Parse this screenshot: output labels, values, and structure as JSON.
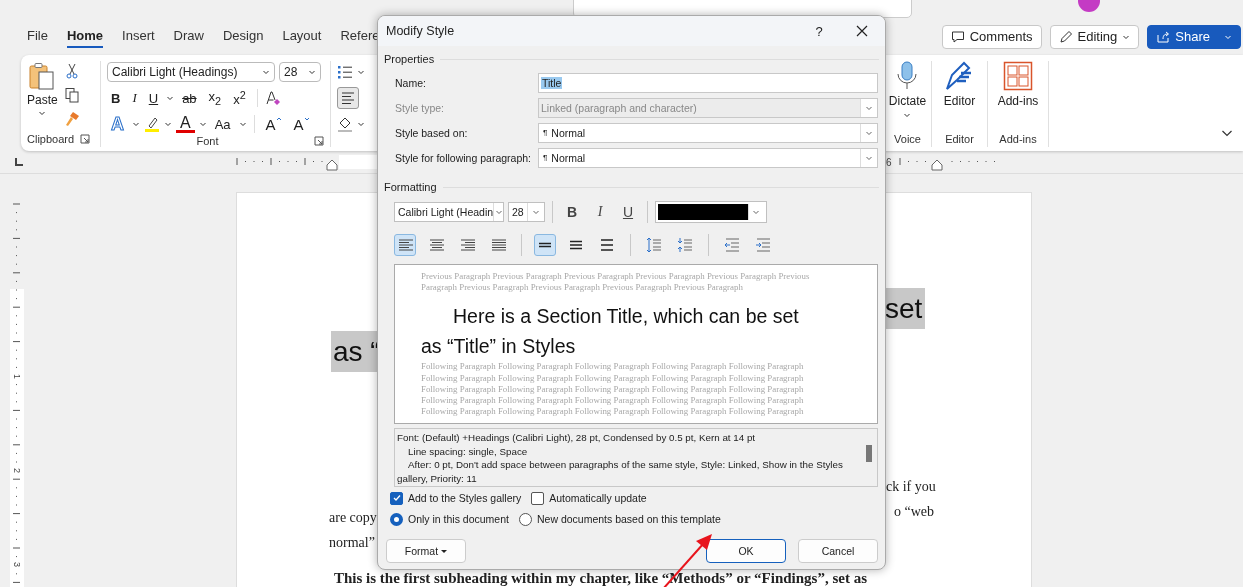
{
  "ribbon_tabs": [
    {
      "label": "File",
      "selected": false
    },
    {
      "label": "Home",
      "selected": true
    },
    {
      "label": "Insert",
      "selected": false
    },
    {
      "label": "Draw",
      "selected": false
    },
    {
      "label": "Design",
      "selected": false
    },
    {
      "label": "Layout",
      "selected": false
    },
    {
      "label": "Refere",
      "selected": false
    }
  ],
  "header_buttons": {
    "comments": "Comments",
    "editing": "Editing",
    "share": "Share"
  },
  "ribbon": {
    "clipboard": {
      "paste": "Paste",
      "label": "Clipboard"
    },
    "font": {
      "name": "Calibri Light (Headings)",
      "size": "28",
      "label": "Font",
      "format_buttons": [
        {
          "label": "B",
          "kind": "bold"
        },
        {
          "label": "I",
          "kind": "italic"
        },
        {
          "label": "U",
          "kind": "underline"
        },
        {
          "label": "ab",
          "kind": "strikethrough"
        },
        {
          "label": "x$_{2}$",
          "kind": "subscript"
        },
        {
          "label": "x$^{2}$",
          "kind": "superscript"
        }
      ],
      "effect_buttons": [
        {
          "label": "A",
          "kind": "text-effects"
        },
        {
          "label": "A",
          "kind": "font-color"
        },
        {
          "label": "Aa",
          "kind": "case"
        },
        {
          "label": "A",
          "kind": "grow"
        },
        {
          "label": "A",
          "kind": "shrink"
        }
      ]
    },
    "paragraph": {
      "align_left": {
        "selected": true
      }
    },
    "voice": {
      "button": "Dictate",
      "label": "Voice"
    },
    "editor": {
      "button": "Editor",
      "label": "Editor"
    },
    "addins": {
      "button": "Add-ins",
      "label": "Add-ins"
    }
  },
  "ruler": {
    "horizontal_number": "6",
    "vertical_numbers": [
      "1",
      "2",
      "3"
    ]
  },
  "document": {
    "title_right": "set",
    "title_left": "as “",
    "body_right": [
      "ck if you",
      "o “web"
    ],
    "body_left": [
      "are copy",
      "normal”"
    ],
    "subheading": "This is the first subheading within my chapter, like “Methods” or “Findings”, set as"
  },
  "dialog": {
    "title": "Modify Style",
    "help": "?",
    "properties_heading": "Properties",
    "fields": [
      {
        "label": "Name:",
        "value": "Title",
        "kind": "text",
        "disabled": false,
        "text_selected": true
      },
      {
        "label": "Style type:",
        "value": "Linked (paragraph and character)",
        "kind": "dropdown",
        "disabled": true
      },
      {
        "label": "Style based on:",
        "prefix": "¶",
        "value": "Normal",
        "kind": "dropdown",
        "disabled": false
      },
      {
        "label": "Style for following paragraph:",
        "prefix": "¶",
        "value": "Normal",
        "kind": "dropdown",
        "disabled": false
      }
    ],
    "formatting_heading": "Formatting",
    "font": "Calibri Light (Headin",
    "size": "28",
    "styles": [
      {
        "label": "B",
        "kind": "bold",
        "selected": false
      },
      {
        "label": "I",
        "kind": "italic",
        "selected": false
      },
      {
        "label": "U",
        "kind": "underline",
        "selected": false
      }
    ],
    "tool_groups": [
      [
        {
          "kind": "align-left",
          "selected": true
        },
        {
          "kind": "align-center",
          "selected": false
        },
        {
          "kind": "align-right",
          "selected": false
        },
        {
          "kind": "justify",
          "selected": false
        }
      ],
      [
        {
          "kind": "single-spacing",
          "selected": true
        },
        {
          "kind": "one-half-spacing",
          "selected": false
        },
        {
          "kind": "double-spacing",
          "selected": false
        }
      ],
      [
        {
          "kind": "increase-spacing",
          "selected": false
        },
        {
          "kind": "decrease-spacing",
          "selected": false
        }
      ],
      [
        {
          "kind": "decrease-indent",
          "selected": false
        },
        {
          "kind": "increase-indent",
          "selected": false
        }
      ]
    ],
    "preview": {
      "previous": "Previous Paragraph Previous Paragraph Previous Paragraph Previous Paragraph Previous Paragraph Previous Paragraph Previous Paragraph Previous Paragraph Previous Paragraph Previous Paragraph",
      "title": "Here is a Section Title, which can be set as “Title” in Styles",
      "following": "Following Paragraph Following Paragraph Following Paragraph Following Paragraph Following Paragraph Following Paragraph Following Paragraph Following Paragraph Following Paragraph Following Paragraph Following Paragraph Following Paragraph Following Paragraph Following Paragraph Following Paragraph Following Paragraph Following Paragraph Following Paragraph Following Paragraph Following Paragraph Following Paragraph Following Paragraph Following Paragraph Following Paragraph Following Paragraph"
    },
    "description": [
      {
        "text": "Font: (Default) +Headings (Calibri Light), 28 pt, Condensed by  0.5 pt, Kern at 14 pt",
        "indented": false
      },
      {
        "text": "Line spacing:  single, Space",
        "indented": true
      },
      {
        "text": "After:  0 pt, Don't add space between paragraphs of the same style, Style: Linked, Show in the Styles gallery, Priority: 11",
        "indented": true
      }
    ],
    "checkboxes": [
      {
        "label": "Add to the Styles gallery",
        "checked": true
      },
      {
        "label": "Automatically update",
        "checked": false
      }
    ],
    "radios": [
      {
        "label": "Only in this document",
        "selected": true
      },
      {
        "label": "New documents based on this template",
        "selected": false
      }
    ],
    "buttons": [
      {
        "label": "Format",
        "kind": "menu"
      },
      {
        "label": "OK",
        "kind": "default"
      },
      {
        "label": "Cancel",
        "kind": "plain"
      }
    ]
  }
}
